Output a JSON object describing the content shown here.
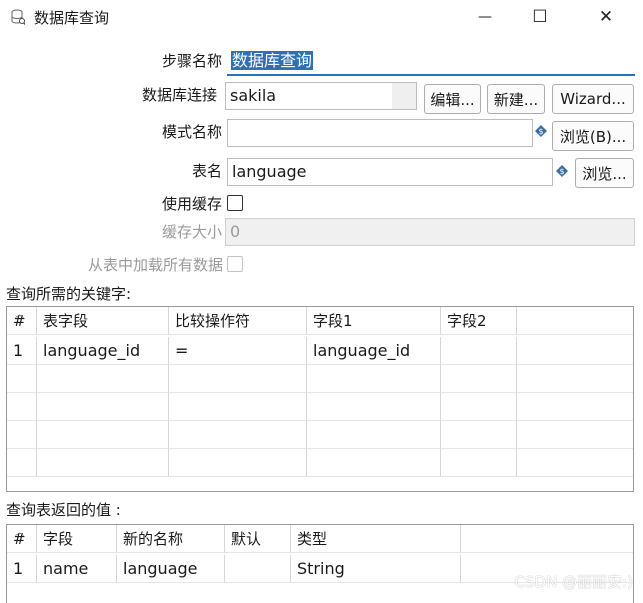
{
  "window": {
    "title": "数据库查询",
    "minimize_glyph": "—",
    "maximize_glyph": "☐",
    "close_glyph": "✕"
  },
  "form": {
    "step_name_label": "步骤名称",
    "step_name_value": "数据库查询",
    "connection_label": "数据库连接",
    "connection_value": "sakila",
    "edit_button": "编辑...",
    "new_button": "新建...",
    "wizard_button": "Wizard...",
    "schema_label": "模式名称",
    "schema_value": "",
    "browse_schema_button": "浏览(B)...",
    "table_label": "表名",
    "table_value": "language",
    "browse_table_button": "浏览...",
    "use_cache_label": "使用缓存",
    "cache_size_label": "缓存大小",
    "cache_size_value": "0",
    "load_all_label": "从表中加载所有数据"
  },
  "keys_section": {
    "label": "查询所需的关键字:",
    "headers": [
      "#",
      "表字段",
      "比较操作符",
      "字段1",
      "字段2"
    ],
    "rows": [
      [
        "1",
        "language_id",
        "=",
        "language_id",
        ""
      ]
    ]
  },
  "return_section": {
    "label": "查询表返回的值 :",
    "headers": [
      "#",
      "字段",
      "新的名称",
      "默认",
      "类型"
    ],
    "rows": [
      [
        "1",
        "name",
        "language",
        "",
        "String"
      ]
    ]
  },
  "watermark": "CSDN @丽丽安:)",
  "icons": {
    "title": "database-icon",
    "variable": "dollar-variable-icon"
  },
  "colors": {
    "focus_accent": "#2f6fb8",
    "variable_icon": "#3a6ea5"
  }
}
